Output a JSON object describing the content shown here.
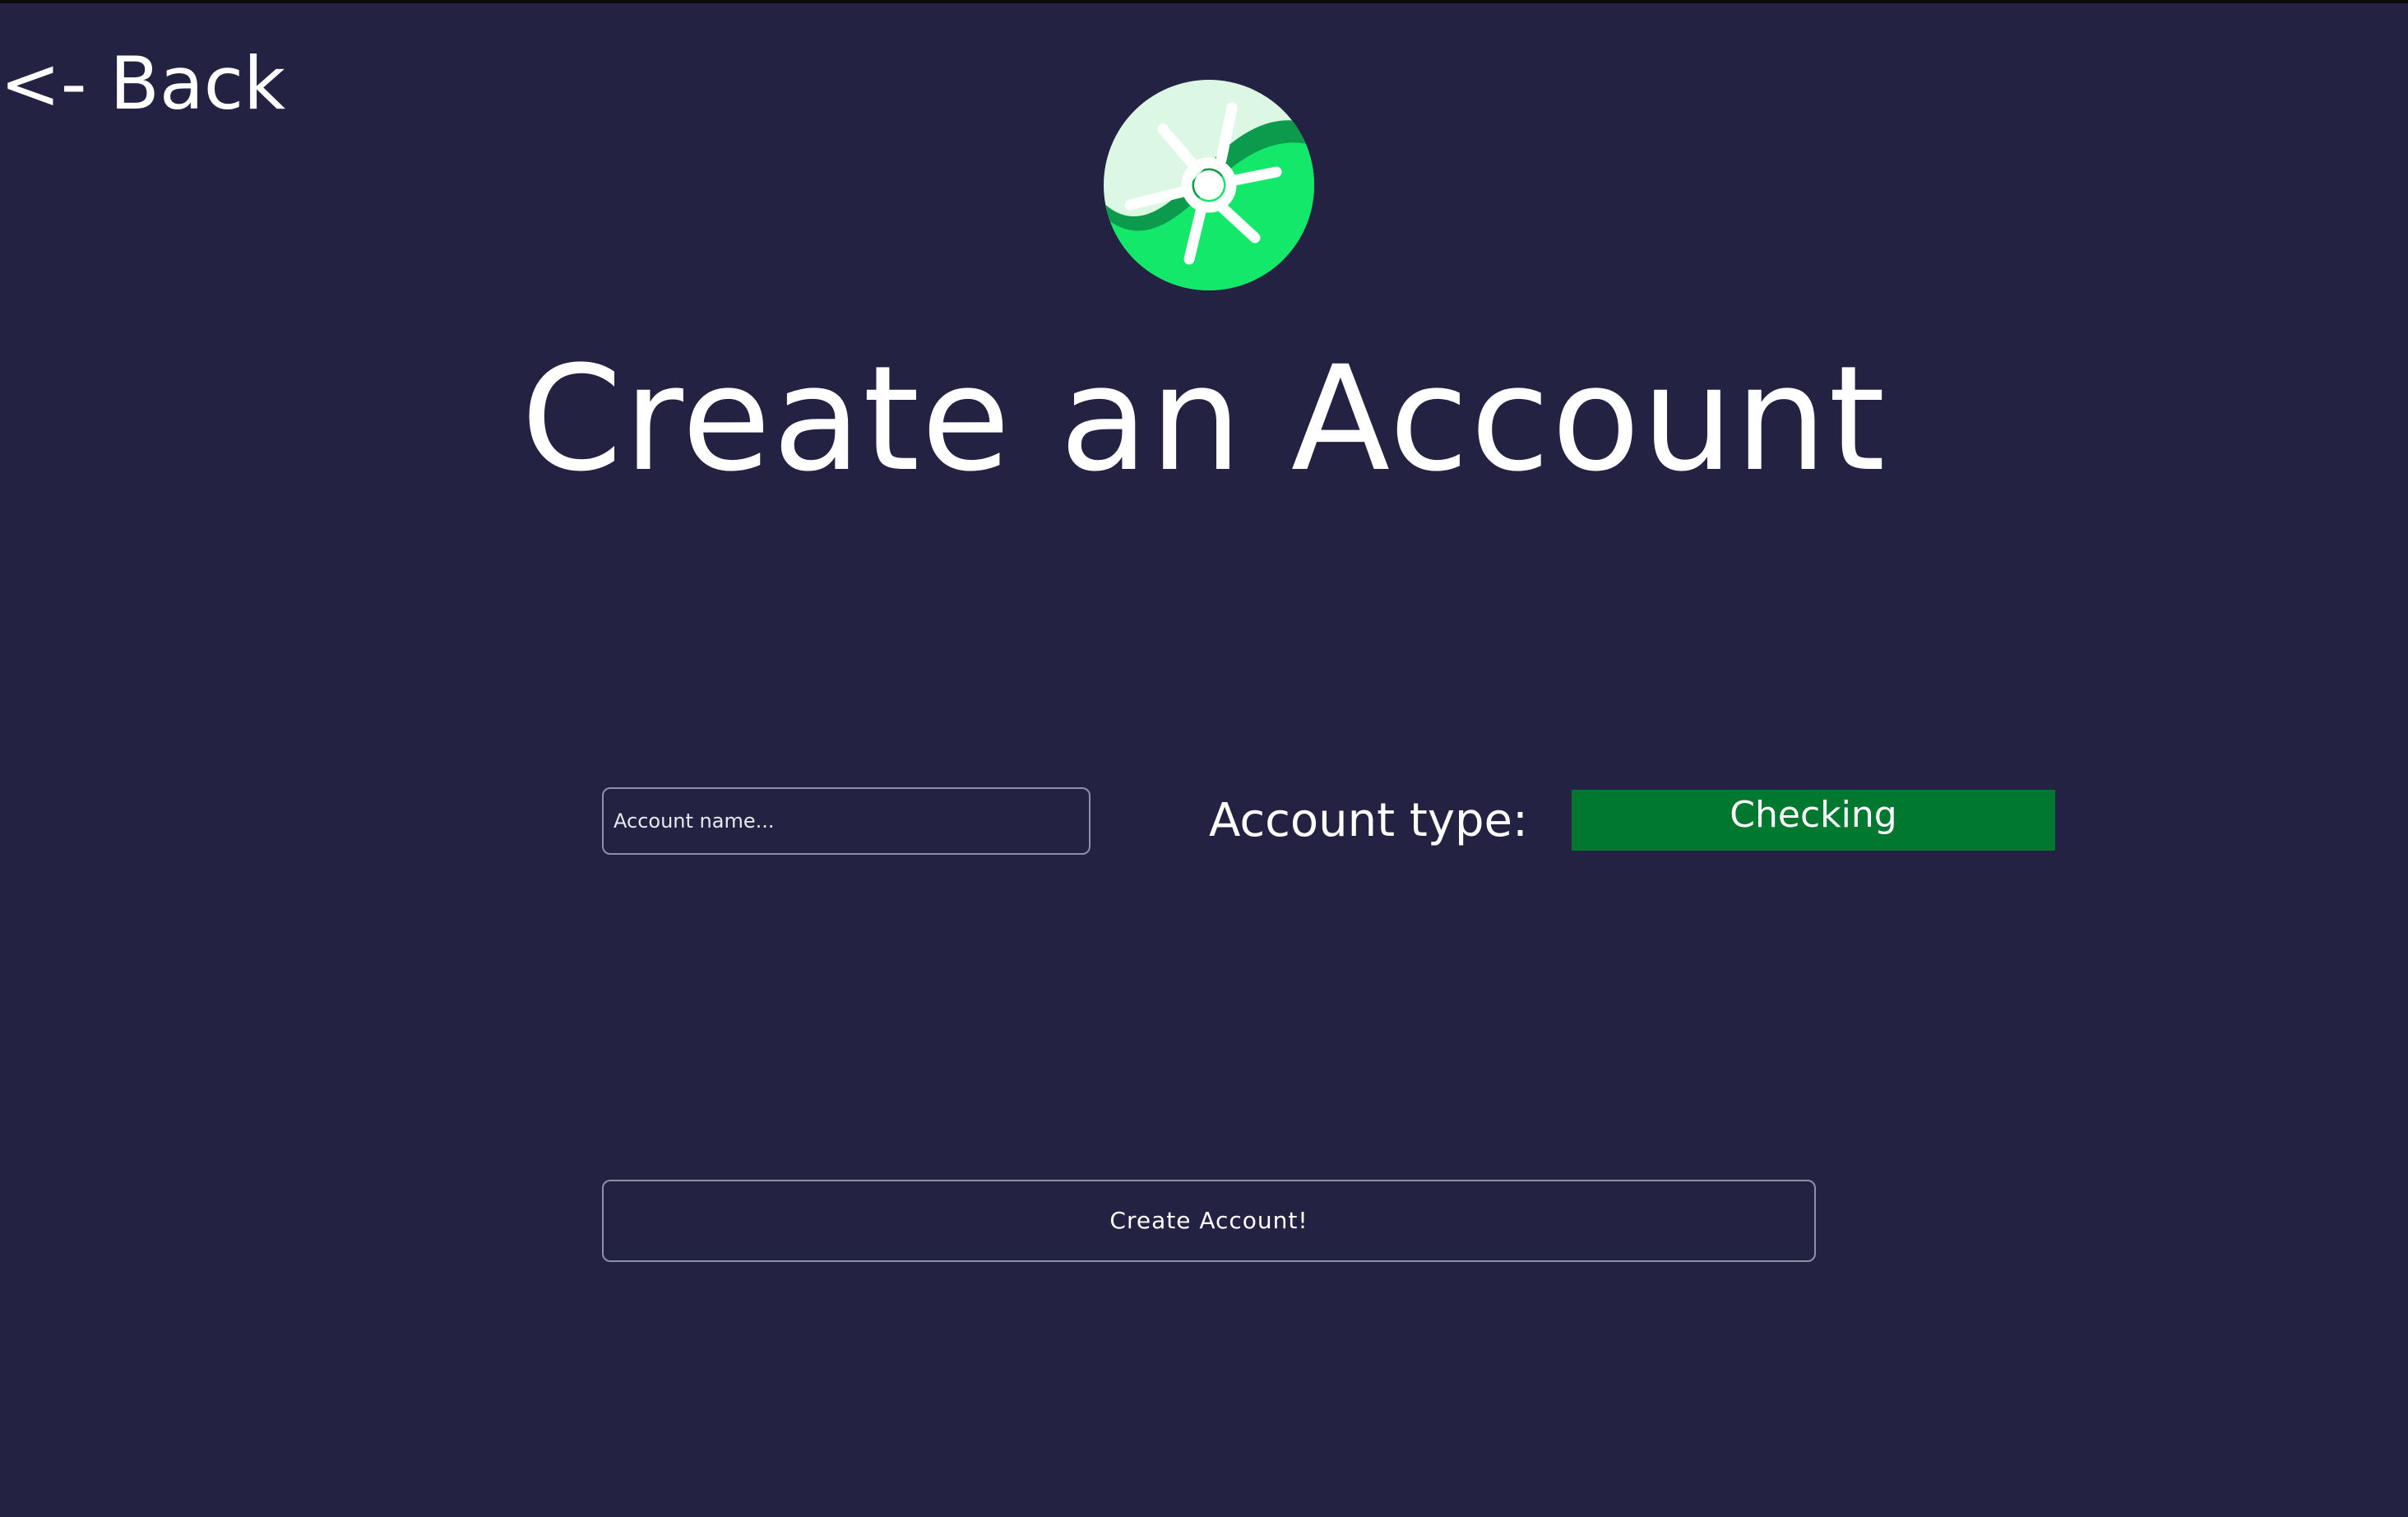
{
  "nav": {
    "back_label": "<- Back"
  },
  "logo": {
    "icon": "sun-wave-logo-icon",
    "colors": {
      "primary": "#14e86a",
      "light": "#dcf8e4",
      "dark": "#0c9a4c"
    }
  },
  "page": {
    "title": "Create an Account",
    "background": "#232242"
  },
  "form": {
    "name_placeholder": "Account name...",
    "name_value": "",
    "type_label": "Account type:",
    "type_selected": "Checking",
    "type_color": "#00782f",
    "submit_label": "Create Account!"
  }
}
